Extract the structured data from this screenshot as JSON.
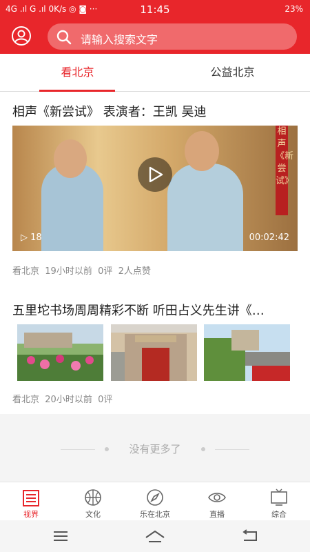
{
  "status": {
    "left": "4G .ıl G .ıl 0K/s ◎ ◙ ···",
    "time": "11:45",
    "right": "23%"
  },
  "search": {
    "placeholder": "请输入搜索文字"
  },
  "tabs": [
    {
      "label": "看北京"
    },
    {
      "label": "公益北京"
    }
  ],
  "articles": [
    {
      "title": "相声《新尝试》  表演者：王凯 吴迪",
      "video": {
        "views": "18",
        "duration": "00:02:42",
        "banner": "相声《新尝试》"
      },
      "source": "看北京",
      "time": "19小时以前",
      "comments": "0评",
      "likes": "2人点赞"
    },
    {
      "title": "五里坨书场周周精彩不断 听田占义先生讲《…",
      "source": "看北京",
      "time": "20小时以前",
      "comments": "0评"
    }
  ],
  "no_more": "没有更多了",
  "bottom_nav": [
    {
      "label": "视界",
      "icon": "news-icon"
    },
    {
      "label": "文化",
      "icon": "ball-icon"
    },
    {
      "label": "乐在北京",
      "icon": "compass-icon"
    },
    {
      "label": "直播",
      "icon": "eye-icon"
    },
    {
      "label": "综合",
      "icon": "tv-icon"
    }
  ],
  "colors": {
    "accent": "#e8262b"
  }
}
